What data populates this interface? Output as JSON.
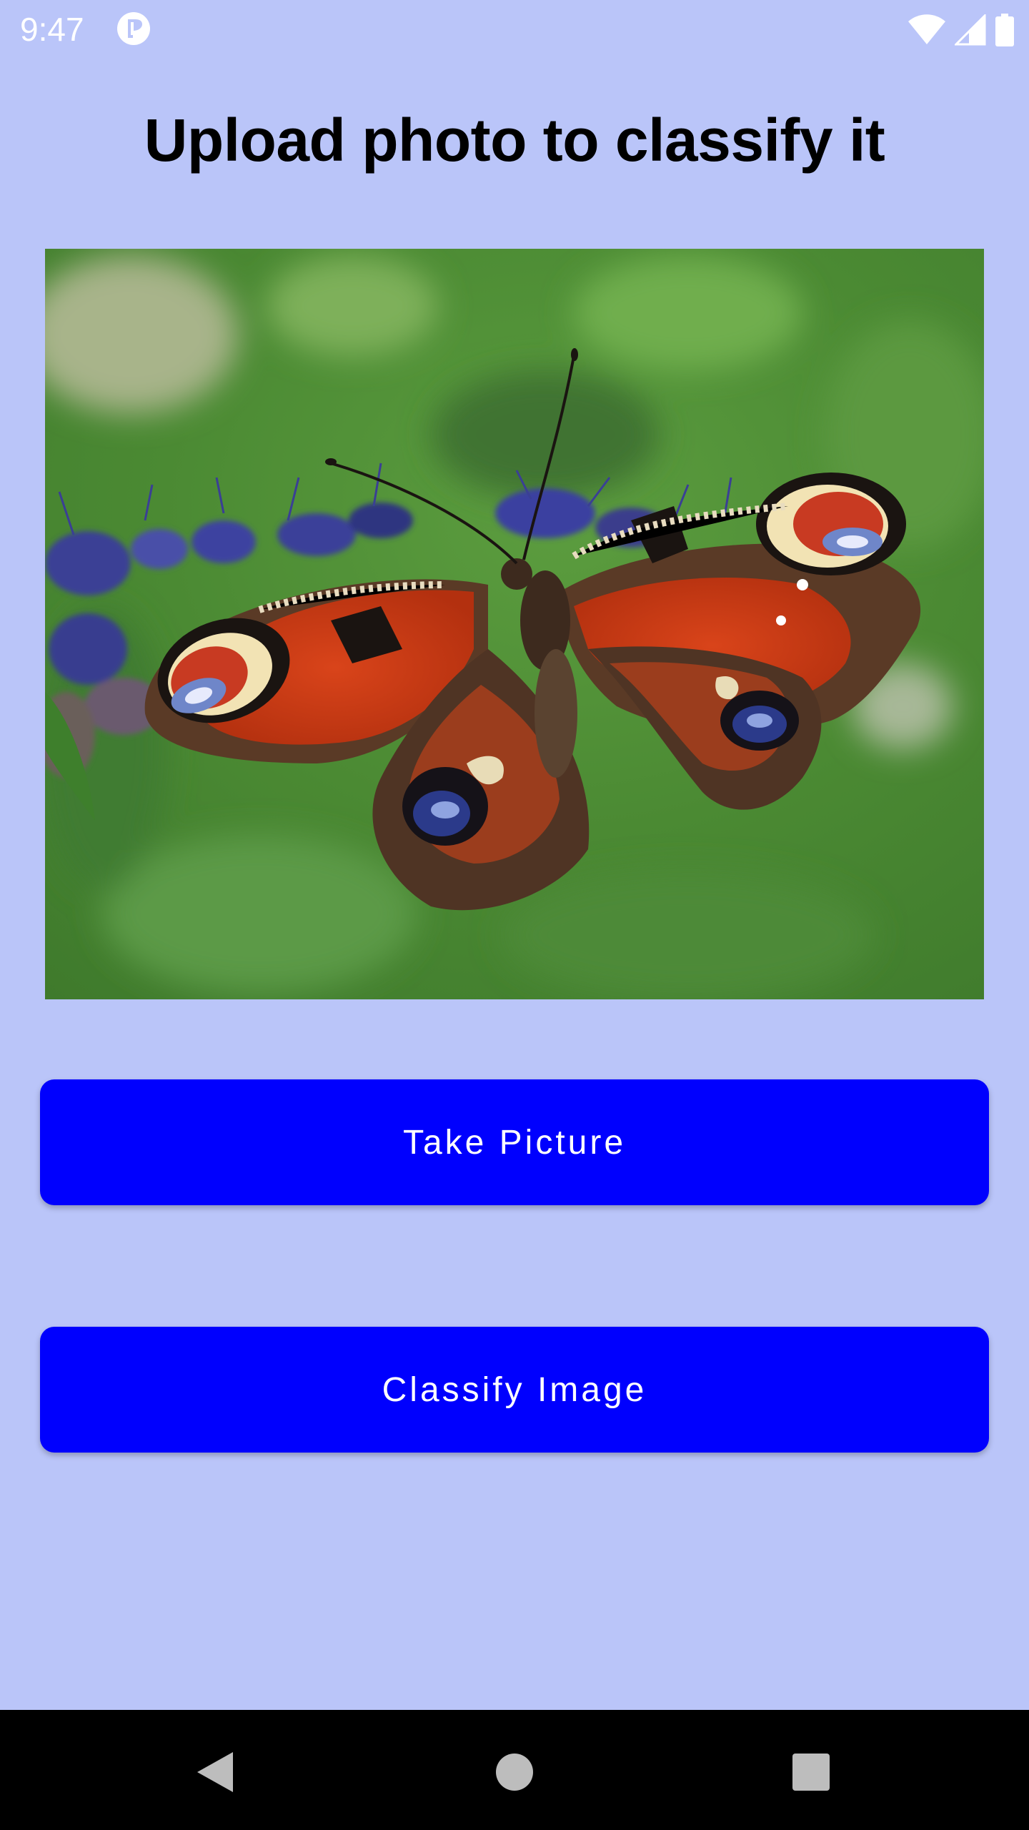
{
  "status_bar": {
    "time": "9:47",
    "app_icon": "app-notification-icon",
    "icons": [
      "wifi-icon",
      "cell-signal-icon",
      "battery-icon"
    ]
  },
  "page": {
    "title": "Upload photo to classify it"
  },
  "image": {
    "subject": "peacock-butterfly-photo"
  },
  "buttons": {
    "take_picture": "Take Picture",
    "classify_image": "Classify Image"
  },
  "nav_bar": {
    "icons": [
      "back-icon",
      "home-icon",
      "recents-icon"
    ]
  },
  "colors": {
    "background": "#bac5f9",
    "button": "#0000fe",
    "button_text": "#ffffff",
    "title_text": "#000000",
    "nav_bar": "#000000"
  }
}
